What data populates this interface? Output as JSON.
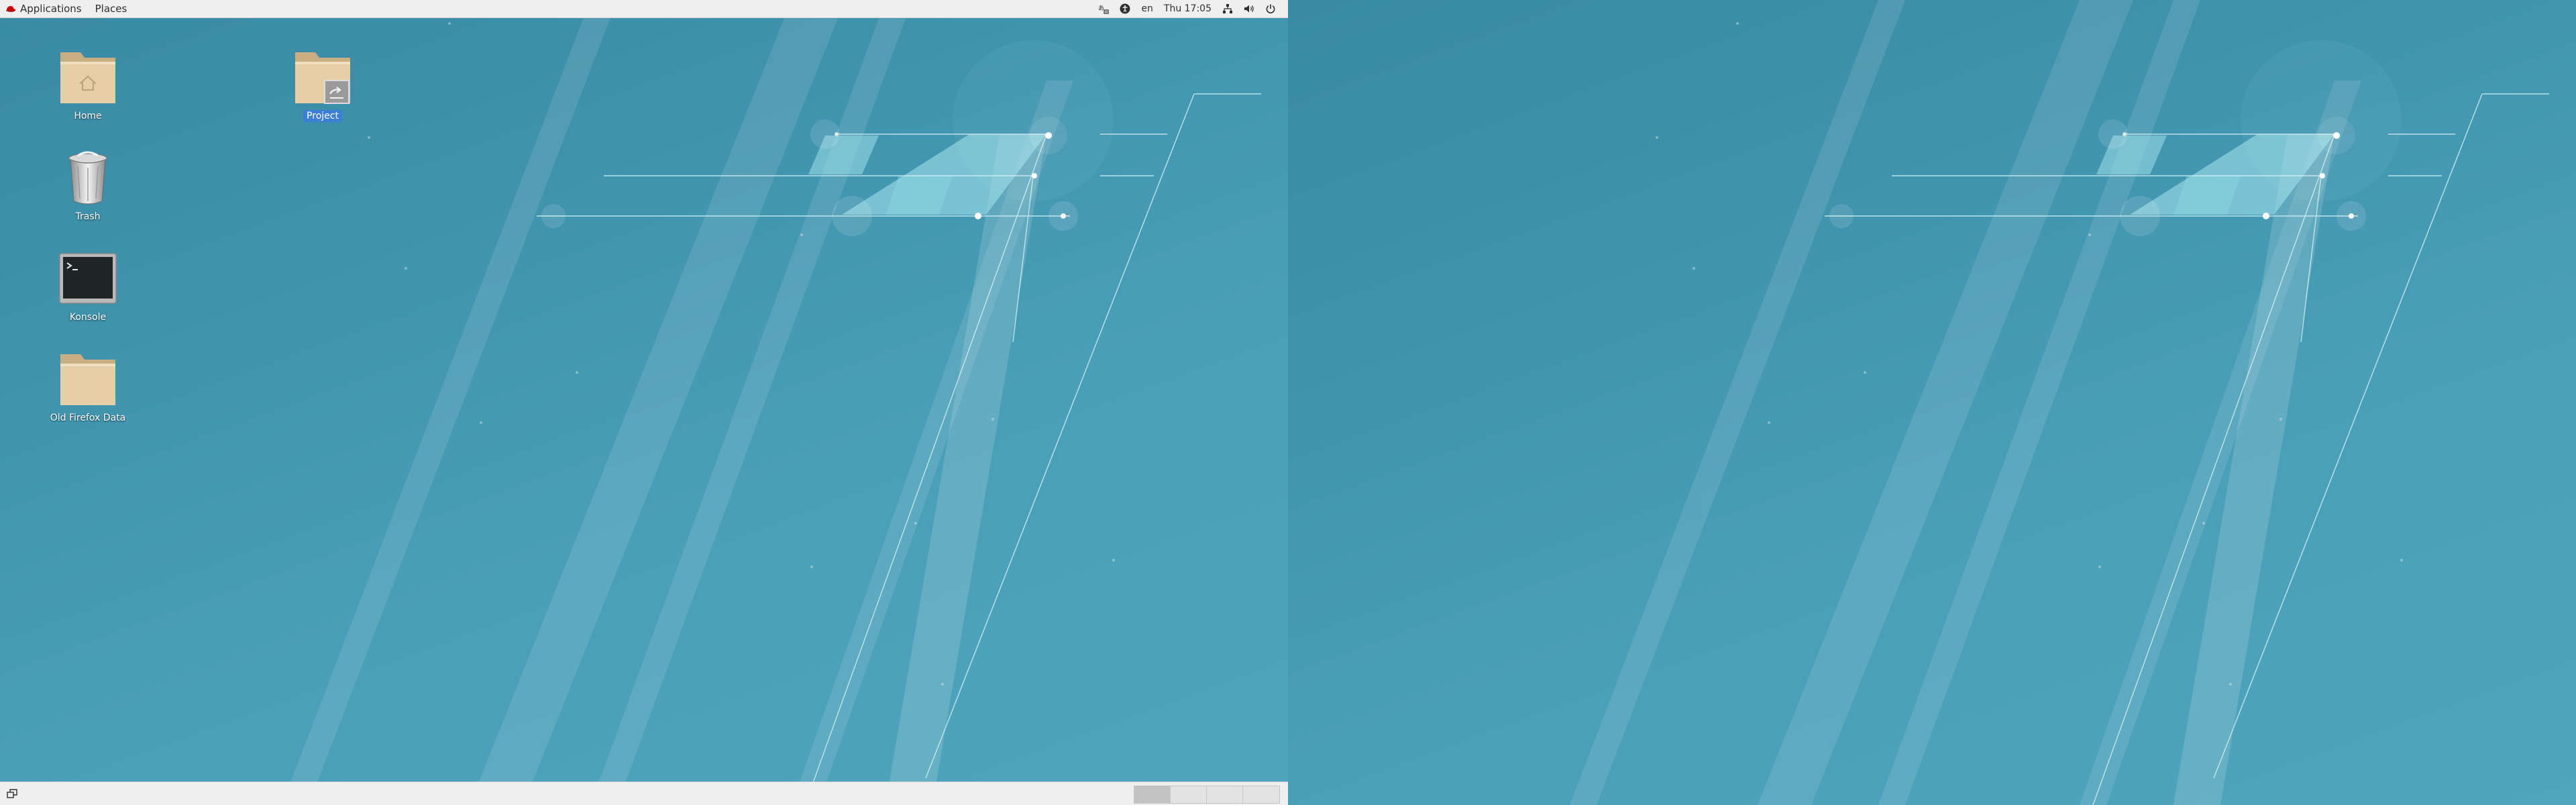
{
  "top_bar": {
    "applications_label": "Applications",
    "places_label": "Places",
    "tray": {
      "language": "en",
      "clock": "Thu 17:05"
    }
  },
  "desktop_icons": [
    {
      "label": "Home",
      "icon": "home-folder-icon"
    },
    {
      "label": "Project",
      "icon": "shared-folder-icon",
      "selected": true
    },
    {
      "label": "Trash",
      "icon": "trash-icon"
    },
    {
      "label": "Konsole",
      "icon": "terminal-icon"
    },
    {
      "label": "Old Firefox Data",
      "icon": "folder-icon"
    }
  ],
  "bottom_bar": {
    "workspaces": 4,
    "active_workspace": 1
  },
  "colors": {
    "wallpaper": "#4a9fb8",
    "panel": "#efefef",
    "selection": "#3b7fd4",
    "folder": "#e6cfa6"
  }
}
